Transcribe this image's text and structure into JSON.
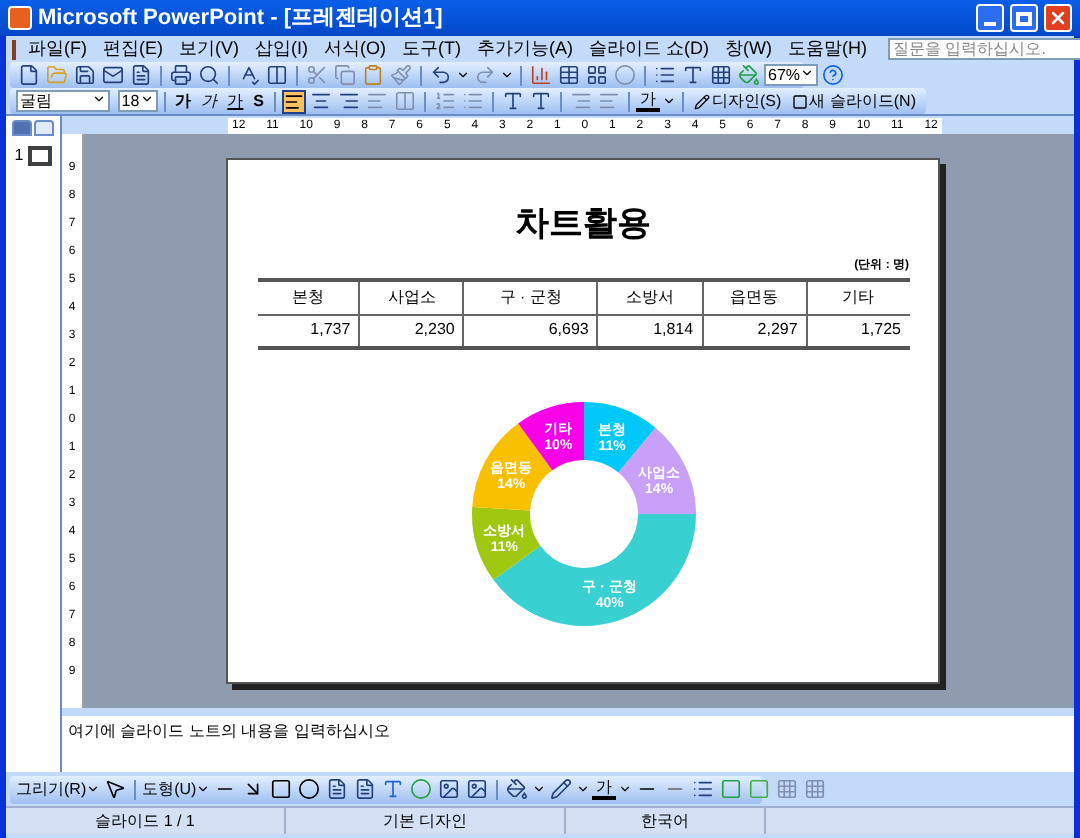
{
  "window": {
    "title": "Microsoft PowerPoint - [프레젠테이션1]"
  },
  "menu": [
    "파일(F)",
    "편집(E)",
    "보기(V)",
    "삽입(I)",
    "서식(O)",
    "도구(T)",
    "추가기능(A)",
    "슬라이드 쇼(D)",
    "창(W)",
    "도움말(H)"
  ],
  "help_search": {
    "placeholder": "질문을 입력하십시오."
  },
  "standard_toolbar": {
    "zoom": "67%"
  },
  "format_toolbar": {
    "font": "굴림",
    "size": "18",
    "bold": "가",
    "italic": "가",
    "underline": "가",
    "shadow": "S",
    "font_color": "가",
    "design": "디자인(S)",
    "new_slide": "새 슬라이드(N)"
  },
  "h_ruler": [
    "12",
    "11",
    "10",
    "9",
    "8",
    "7",
    "6",
    "5",
    "4",
    "3",
    "2",
    "1",
    "0",
    "1",
    "2",
    "3",
    "4",
    "5",
    "6",
    "7",
    "8",
    "9",
    "10",
    "11",
    "12"
  ],
  "v_ruler": [
    "9",
    "8",
    "7",
    "6",
    "5",
    "4",
    "3",
    "2",
    "1",
    "0",
    "1",
    "2",
    "3",
    "4",
    "5",
    "6",
    "7",
    "8",
    "9"
  ],
  "slides_pane": {
    "tabs": [
      {
        "selected": true
      },
      {
        "selected": false
      }
    ],
    "slides": [
      {
        "number": "1",
        "selected": true
      }
    ]
  },
  "slide": {
    "title": "차트활용",
    "unit": "(단위 : 명)",
    "table": {
      "columns": [
        "본청",
        "사업소",
        "구 · 군청",
        "소방서",
        "읍면동",
        "기타"
      ],
      "rows": [
        [
          "1,737",
          "2,230",
          "6,693",
          "1,814",
          "2,297",
          "1,725"
        ]
      ]
    },
    "chart_data": {
      "type": "donut",
      "categories": [
        "본청",
        "사업소",
        "구 · 군청",
        "소방서",
        "읍면동",
        "기타"
      ],
      "series": [
        {
          "values": [
            11,
            14,
            40,
            11,
            14,
            10
          ]
        }
      ],
      "value_labels": [
        "11%",
        "14%",
        "40%",
        "11%",
        "14%",
        "10%"
      ],
      "colors": [
        "#00c8f8",
        "#c8a0f8",
        "#38d0d0",
        "#a0c810",
        "#f8c000",
        "#f800e8"
      ]
    }
  },
  "notes": {
    "text": "여기에 슬라이드 노트의 내용을 입력하십시오"
  },
  "drawing_toolbar": {
    "draw": "그리기(R)",
    "shapes": "도형(U)",
    "font_color": "가"
  },
  "status_bar": [
    "슬라이드 1 / 1",
    "기본 디자인",
    "한국어"
  ]
}
